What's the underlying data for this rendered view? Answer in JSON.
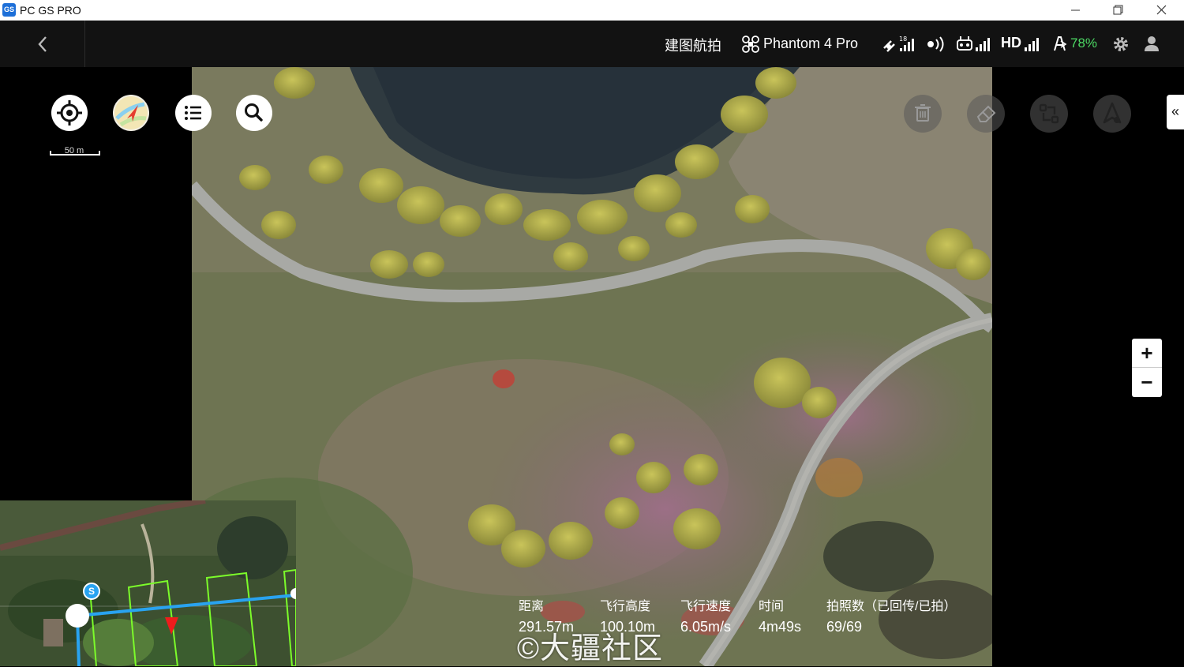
{
  "window": {
    "title": "PC GS PRO",
    "logo_text": "GS"
  },
  "topbar": {
    "mode": "建图航拍",
    "drone_model": "Phantom 4 Pro",
    "hd_label": "HD",
    "battery_percent": "78%",
    "colors": {
      "battery": "#4cd964"
    }
  },
  "map": {
    "scale_label": "50 m",
    "zoom_in": "+",
    "zoom_out": "−",
    "collapse": "«"
  },
  "minimap": {
    "start_marker": "S"
  },
  "telemetry": [
    {
      "label": "距离",
      "value": "291.57m"
    },
    {
      "label": "飞行高度",
      "value": "100.10m"
    },
    {
      "label": "飞行速度",
      "value": "6.05m/s"
    },
    {
      "label": "时间",
      "value": "4m49s"
    },
    {
      "label": "拍照数（已回传/已拍）",
      "value": "69/69"
    }
  ],
  "watermark": "©大疆社区"
}
